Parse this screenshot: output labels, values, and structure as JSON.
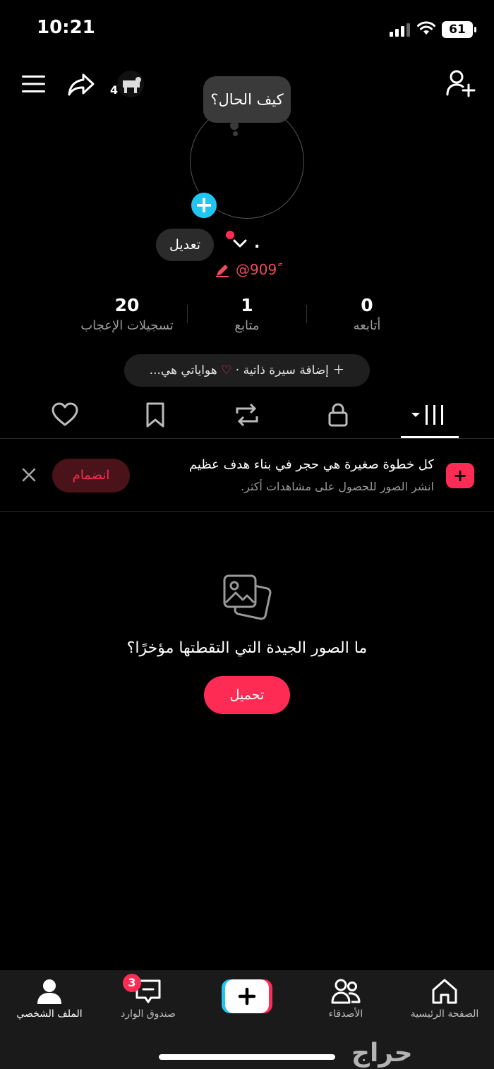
{
  "status_bar": {
    "time": "10:21",
    "battery": "61"
  },
  "header": {
    "story_count": "4"
  },
  "profile": {
    "status_bubble": "كيف الحال؟",
    "edit_label": "تعديل",
    "display_name": ".",
    "username": "@909ً"
  },
  "stats": [
    {
      "value": "20",
      "label": "تسجيلات الإعجاب"
    },
    {
      "value": "1",
      "label": "متابع"
    },
    {
      "value": "0",
      "label": "أتابعه"
    }
  ],
  "bio": {
    "add_label": "إضافة سيرة ذاتية",
    "separator": "·",
    "hobbies": "هواياتي هي..."
  },
  "banner": {
    "title": "كل خطوة صغيرة هي حجر في بناء هدف عظيم",
    "subtitle": "انشر الصور للحصول على مشاهدات أكثر.",
    "join_label": "انضمام"
  },
  "empty_state": {
    "title": "ما الصور الجيدة التي التقطتها مؤخرًا؟",
    "upload_label": "تحميل"
  },
  "bottom_nav": {
    "profile": "الملف الشخصي",
    "inbox": "صندوق الوارد",
    "inbox_badge": "3",
    "friends": "الأصدقاء",
    "home": "الصفحة الرئيسية"
  },
  "watermark": "حراج",
  "colors": {
    "accent": "#fe2c55",
    "cyan": "#20c5f0",
    "background": "#000000"
  }
}
